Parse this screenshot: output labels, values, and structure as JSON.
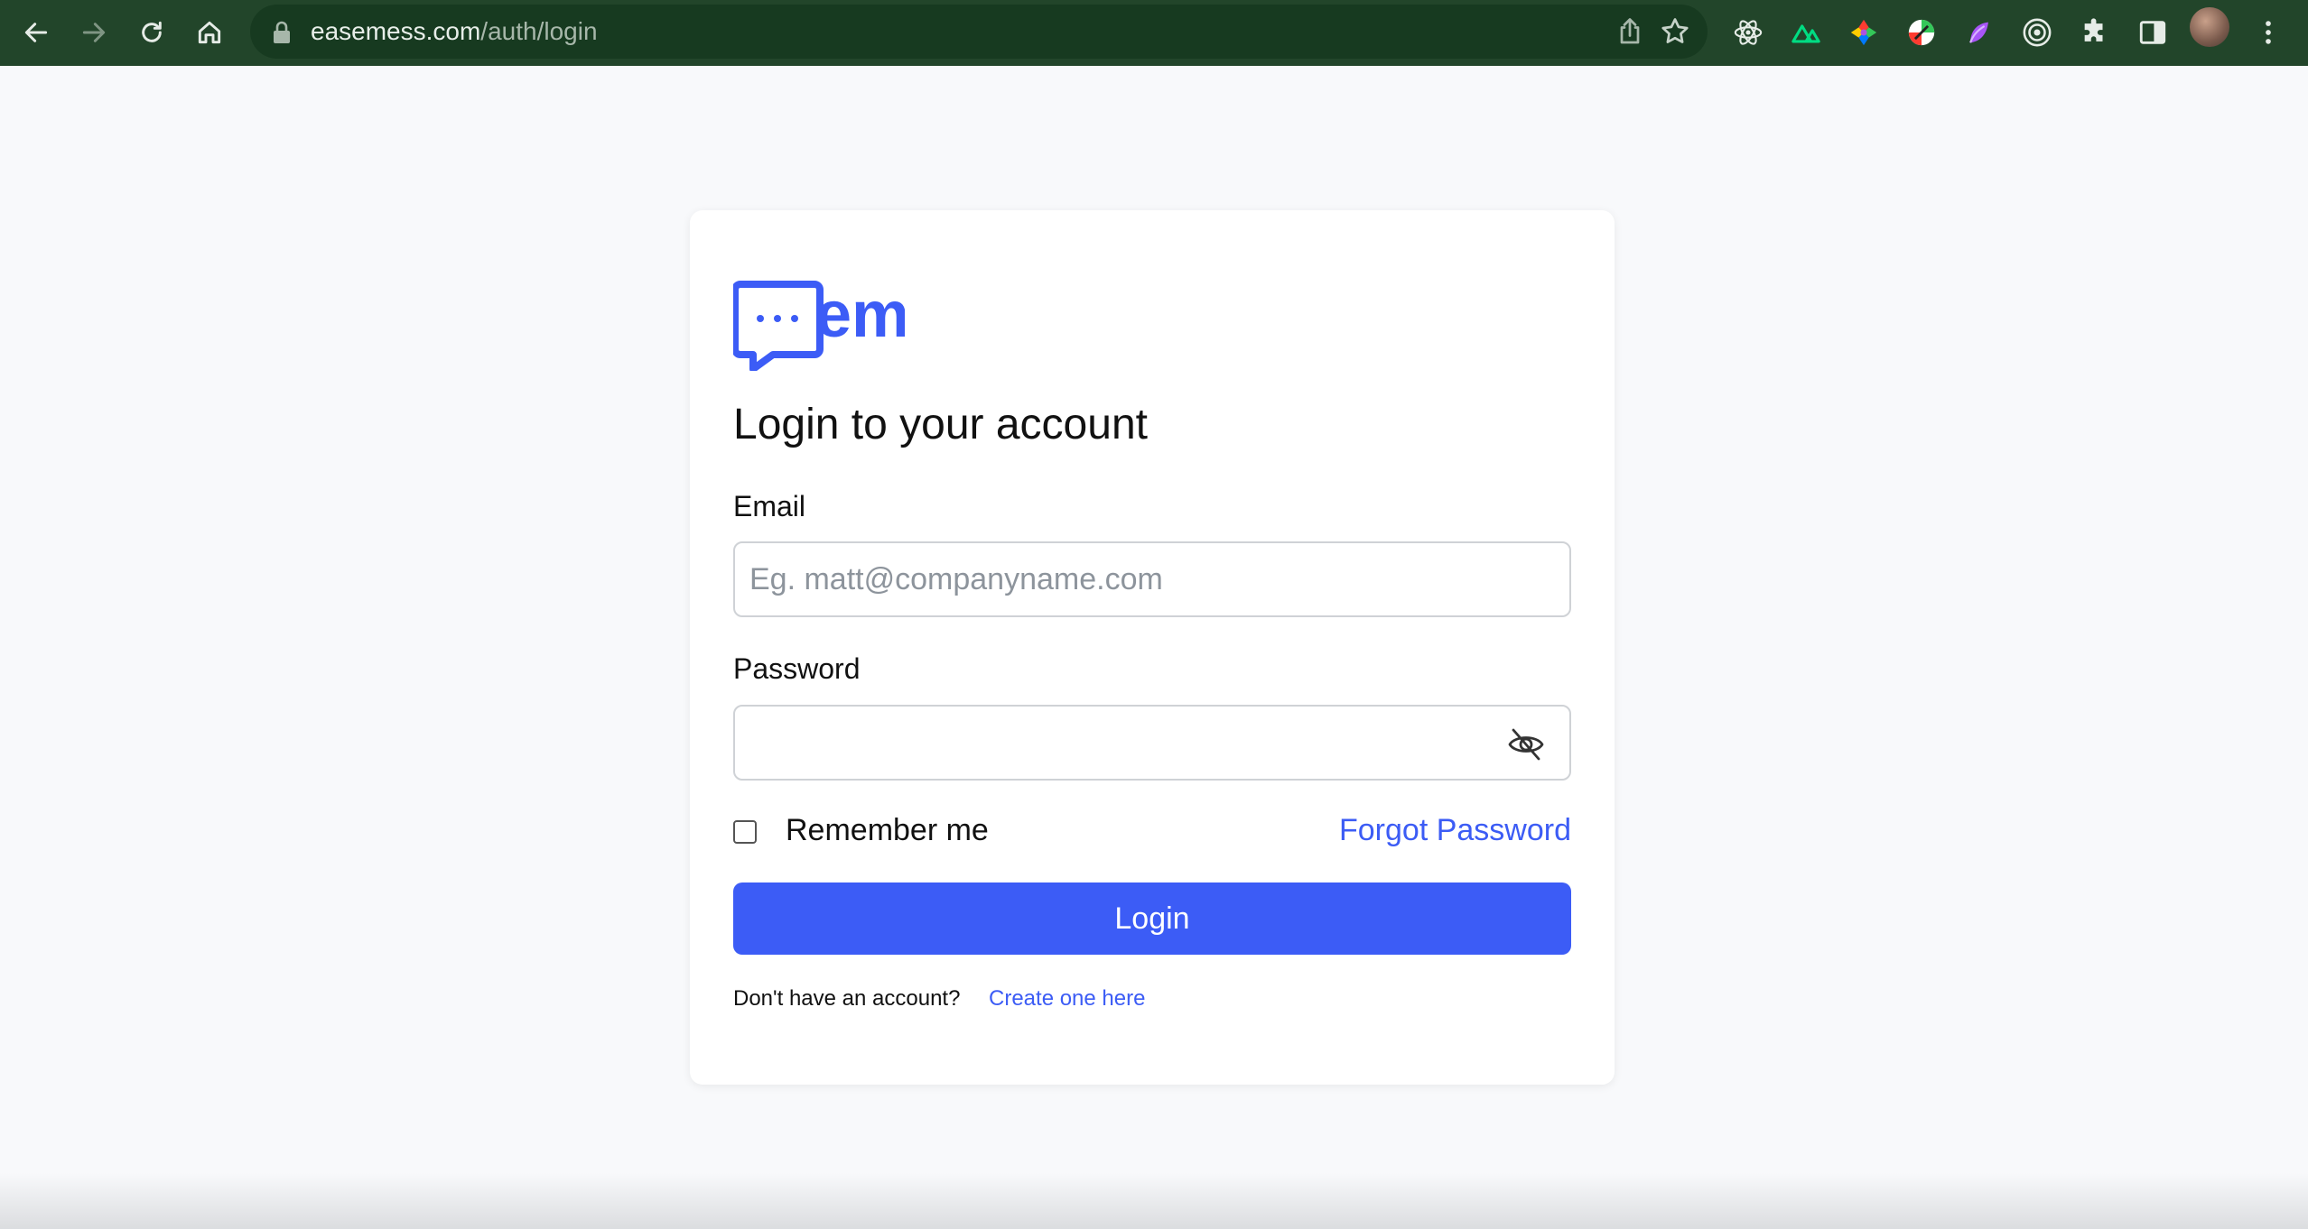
{
  "browser": {
    "url_host": "easemess.com",
    "url_path": "/auth/login",
    "colors": {
      "toolbar": "#22452a",
      "omnibox": "#173a20"
    },
    "nav_icons": [
      "back-arrow-icon",
      "forward-arrow-icon",
      "reload-icon",
      "home-icon"
    ],
    "omnibox_icons": [
      "share-icon",
      "bookmark-star-icon"
    ],
    "extension_icons": [
      "react-devtools-icon",
      "nuxt-icon",
      "colorful-extension-icon",
      "dial-extension-icon",
      "purple-extension-icon",
      "target-extension-icon",
      "extensions-puzzle-icon",
      "side-panel-icon"
    ]
  },
  "login": {
    "logo_text": "em",
    "heading": "Login to your account",
    "email_label": "Email",
    "email_placeholder": "Eg. matt@companyname.com",
    "email_value": "",
    "password_label": "Password",
    "password_value": "",
    "remember_label": "Remember me",
    "remember_checked": false,
    "forgot_label": "Forgot Password",
    "login_button": "Login",
    "no_account_text": "Don't have an account?",
    "create_link": "Create one here",
    "colors": {
      "accent": "#3c5cf6"
    }
  }
}
